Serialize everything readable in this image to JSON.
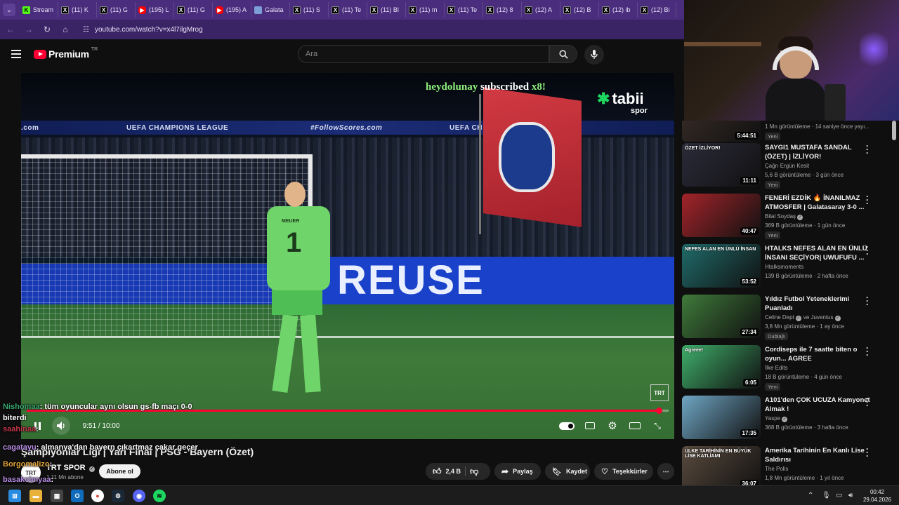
{
  "browser": {
    "tabs": [
      {
        "label": "Stream",
        "icon": "kick-icon"
      },
      {
        "label": "(11) K",
        "icon": "x-icon"
      },
      {
        "label": "(11) G",
        "icon": "x-icon"
      },
      {
        "label": "(195) L",
        "icon": "youtube-icon"
      },
      {
        "label": "(11) G",
        "icon": "x-icon"
      },
      {
        "label": "(195) A",
        "icon": "youtube-icon"
      },
      {
        "label": "Galata",
        "icon": "doc-icon"
      },
      {
        "label": "(11) S",
        "icon": "x-icon"
      },
      {
        "label": "(11) Te",
        "icon": "x-icon"
      },
      {
        "label": "(11) Bl",
        "icon": "x-icon"
      },
      {
        "label": "(11) m",
        "icon": "x-icon"
      },
      {
        "label": "(11) Te",
        "icon": "x-icon"
      },
      {
        "label": "(12) 8",
        "icon": "x-icon"
      },
      {
        "label": "(12) A",
        "icon": "x-icon"
      },
      {
        "label": "(12) B",
        "icon": "x-icon"
      },
      {
        "label": "(12) ib",
        "icon": "x-icon"
      },
      {
        "label": "(12) Bi",
        "icon": "x-icon"
      }
    ],
    "url": "youtube.com/watch?v=x4l7ilgMrog"
  },
  "youtube": {
    "logo_text": "Premium",
    "region": "TR",
    "search_placeholder": "Ara"
  },
  "player": {
    "overlay_user": "heydolunay",
    "overlay_text": "subscribed",
    "overlay_count": "x8!",
    "broadcaster_logo": "tabii",
    "broadcaster_sub": "spor",
    "channel_badge": "TRT",
    "board_left": "UEFA CHAMPIONS LEAGUE",
    "board_mid": "#FollowScores.com",
    "board_right": "UEFA CH",
    "board_com": ".com",
    "ad_text": "REUSE",
    "keeper_name": "MEUER",
    "keeper_number": "1",
    "time_display": "9:51 / 10:00",
    "progress": 0.985,
    "accent": "#ff0033"
  },
  "chat": [
    {
      "user": "Nishomaa",
      "message": ": tüm oyuncular aynı olsun gs-fb maçı 0-0",
      "color": "#3aa86f"
    },
    {
      "user": "",
      "message": "biterdi",
      "color": "#ffffff"
    },
    {
      "user": "saahinaa",
      "message": ":",
      "color": "#c0374a"
    },
    {
      "user": "cagatayu",
      "message": ": almanya'dan bayern çıkartmaz çakar geçer",
      "color": "#b88de6"
    },
    {
      "user": "Borgomalizo",
      "message": ":",
      "color": "#e0a23a"
    },
    {
      "user": "basakcimyaa",
      "message": ":",
      "color": "#b88de6"
    }
  ],
  "video": {
    "title": "Şampiyonlar Ligi | Yarı Final | PSG - Bayern (Özet)",
    "channel": "TRT SPOR",
    "subscribers": "1,11 Mn abone",
    "subscribe_label": "Abone ol",
    "likes": "2,4 B",
    "share_label": "Paylaş",
    "save_label": "Kaydet",
    "thanks_label": "Teşekkürler"
  },
  "recommended": [
    {
      "title": "",
      "channel": "",
      "meta": "1 Mn görüntüleme · 14 saniye önce yayı...",
      "duration": "5:44:51",
      "badge": "Yeni",
      "thumb": "#3a2d28"
    },
    {
      "title": "SAYGI1 MUSTAFA SANDAL (ÖZET) | İZLİYOR!",
      "channel": "Çağrı Ergün Kesit",
      "meta": "5,6 B görüntüleme · 3 gün önce",
      "duration": "11:11",
      "badge": "Yeni",
      "thumb": "#2b2b3a",
      "thumb_text": "ÖZET İZLİYOR!"
    },
    {
      "title": "FENERİ EZDİK 🔥 İNANILMAZ ATMOSFER | Galatasaray 3-0 ...",
      "channel": "Bilal Soydaş",
      "verified": true,
      "meta": "369 B görüntüleme · 1 gün önce",
      "duration": "40:47",
      "badge": "Yeni",
      "thumb": "#a3242a"
    },
    {
      "title": "HTALKS NEFES ALAN EN ÜNLÜ İNSANI SEÇİYOR| UWUFUFU ...",
      "channel": "Htalksmoments",
      "meta": "139 B görüntüleme · 2 hafta önce",
      "duration": "53:52",
      "badge": "",
      "thumb": "#1f6b6a",
      "thumb_text": "NEFES ALAN EN ÜNLÜ İNSAN"
    },
    {
      "title": "Yıldız Futbol Yeteneklerimi Puanladı",
      "channel": "Celine Dept",
      "channel2": "ve Juventus",
      "verified": true,
      "meta": "3,8 Mn görüntüleme · 1 ay önce",
      "duration": "27:34",
      "badge": "Dublajlı",
      "thumb": "#3f7a3a"
    },
    {
      "title": "Cordiseps ile 7 saatte biten o oyun... AGREE",
      "channel": "İlke Edits",
      "meta": "18 B görüntüleme · 4 gün önce",
      "duration": "6:05",
      "badge": "Yeni",
      "thumb": "#3fae6a",
      "thumb_text": "Agreee!"
    },
    {
      "title": "A101'den ÇOK UCUZA Kamyonet Almak !",
      "channel": "Yaspe",
      "verified": true,
      "meta": "368 B görüntüleme · 3 hafta önce",
      "duration": "17:35",
      "badge": "",
      "thumb": "#6fa6c4"
    },
    {
      "title": "Amerika Tarihinin En Kanlı Lise Saldırısı",
      "channel": "The Polis",
      "meta": "1,8 Mn görüntüleme · 1 yıl önce",
      "duration": "36:07",
      "badge": "",
      "thumb": "#5a4b3e",
      "thumb_text": "ÜLKE TARİHİNİN EN BÜYÜK LİSE KATLİAMI"
    }
  ],
  "taskbar": {
    "time": "00:42",
    "date": "29.04.2026",
    "icons": [
      "windows-start-icon",
      "file-explorer-icon",
      "store-icon",
      "outlook-icon",
      "chrome-icon",
      "steam-icon",
      "discord-icon",
      "spotify-icon"
    ]
  }
}
